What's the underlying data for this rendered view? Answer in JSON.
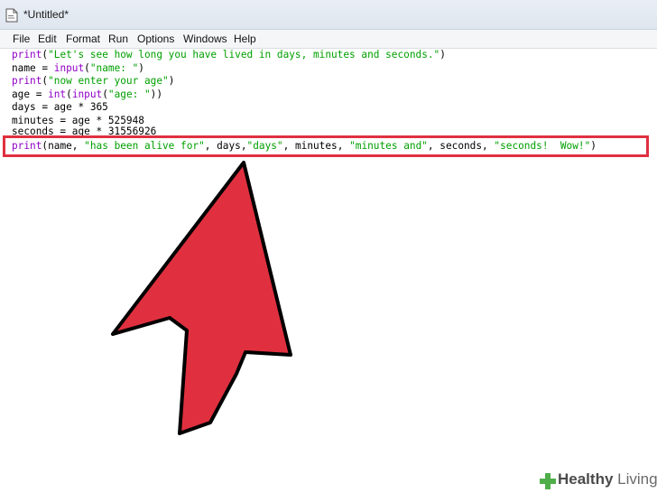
{
  "window": {
    "title": "*Untitled*"
  },
  "menu": [
    "File",
    "Edit",
    "Format",
    "Run",
    "Options",
    "Windows",
    "Help"
  ],
  "code": {
    "lines": [
      [
        {
          "t": "print",
          "c": "kw"
        },
        {
          "t": "(",
          "c": ""
        },
        {
          "t": "\"Let's see how long you have lived in days, minutes and seconds.\"",
          "c": "str"
        },
        {
          "t": ")",
          "c": ""
        }
      ],
      [
        {
          "t": "name = ",
          "c": ""
        },
        {
          "t": "input",
          "c": "kw"
        },
        {
          "t": "(",
          "c": ""
        },
        {
          "t": "\"name: \"",
          "c": "str"
        },
        {
          "t": ")",
          "c": ""
        }
      ],
      [
        {
          "t": "print",
          "c": "kw"
        },
        {
          "t": "(",
          "c": ""
        },
        {
          "t": "\"now enter your age\"",
          "c": "str"
        },
        {
          "t": ")",
          "c": ""
        }
      ],
      [
        {
          "t": "age = ",
          "c": ""
        },
        {
          "t": "int",
          "c": "kw"
        },
        {
          "t": "(",
          "c": ""
        },
        {
          "t": "input",
          "c": "kw"
        },
        {
          "t": "(",
          "c": ""
        },
        {
          "t": "\"age: \"",
          "c": "str"
        },
        {
          "t": "))",
          "c": ""
        }
      ],
      [
        {
          "t": "days = age * 365",
          "c": ""
        }
      ],
      [
        {
          "t": "minutes = age * 525948",
          "c": ""
        }
      ],
      [
        {
          "t": "seconds = age * 31556926",
          "c": ""
        }
      ],
      [
        {
          "t": "print",
          "c": "kw"
        },
        {
          "t": "(name, ",
          "c": ""
        },
        {
          "t": "\"has been alive for\"",
          "c": "str"
        },
        {
          "t": ", days,",
          "c": ""
        },
        {
          "t": "\"days\"",
          "c": "str"
        },
        {
          "t": ", minutes, ",
          "c": ""
        },
        {
          "t": "\"minutes and\"",
          "c": "str"
        },
        {
          "t": ", seconds, ",
          "c": ""
        },
        {
          "t": "\"seconds!  Wow!\"",
          "c": "str"
        },
        {
          "t": ")",
          "c": ""
        }
      ]
    ]
  },
  "colors": {
    "highlight": "#e03040",
    "arrow_fill": "#e0303f",
    "keyword": "#9000c8",
    "string": "#00a000",
    "background": "#aeda9a"
  },
  "watermark": {
    "icon": "wikihow-cross-icon",
    "text_bold": "Healthy",
    "text_rest": " Living"
  }
}
